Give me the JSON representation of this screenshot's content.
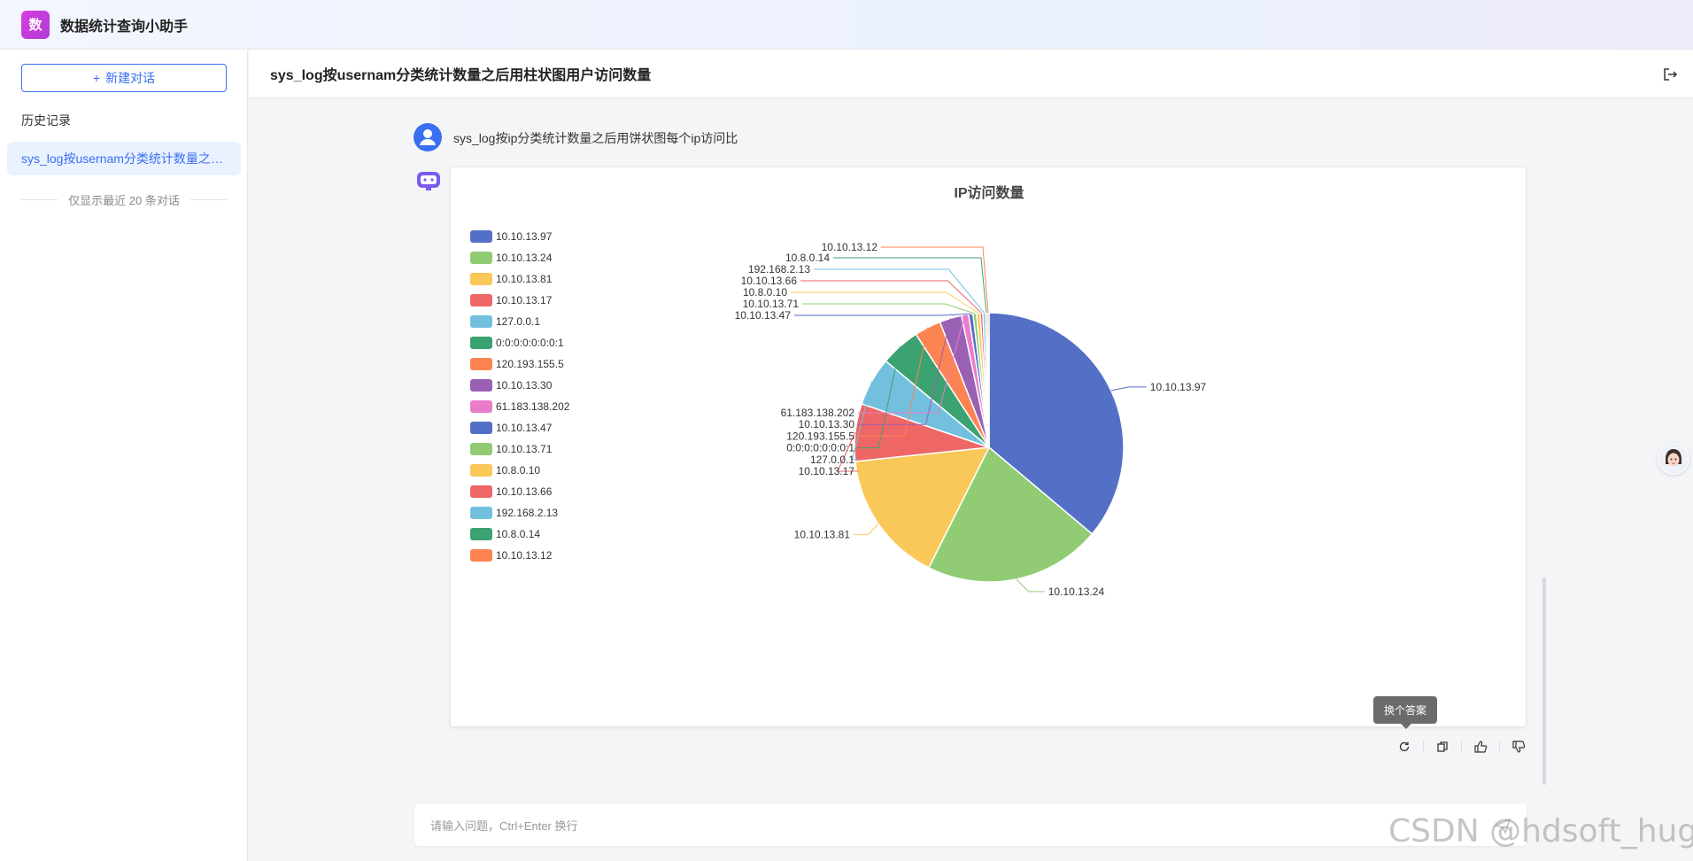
{
  "app": {
    "logo_char": "数",
    "title": "数据统计查询小助手"
  },
  "sidebar": {
    "new_chat_label": "新建对话",
    "history_title": "历史记录",
    "history_items": [
      "sys_log按usernam分类统计数量之后用柱状图用户访问数量"
    ],
    "history_note": "仅显示最近 20 条对话"
  },
  "main": {
    "title": "sys_log按usernam分类统计数量之后用柱状图用户访问数量",
    "user_message": "sys_log按ip分类统计数量之后用饼状图每个ip访问比"
  },
  "chart_data": {
    "type": "pie",
    "title": "IP访问数量",
    "legend_position": "left",
    "colors": [
      "#5470c6",
      "#91cc75",
      "#fac858",
      "#ee6666",
      "#73c0de",
      "#3ba272",
      "#fc8452",
      "#9a60b4",
      "#ea7ccc",
      "#5470c6",
      "#91cc75",
      "#fac858",
      "#ee6666",
      "#73c0de",
      "#3ba272",
      "#fc8452"
    ],
    "labels": [
      "10.10.13.97",
      "10.10.13.24",
      "10.10.13.81",
      "10.10.13.17",
      "127.0.0.1",
      "0:0:0:0:0:0:0:1",
      "120.193.155.5",
      "10.10.13.30",
      "61.183.138.202",
      "10.10.13.47",
      "10.10.13.71",
      "10.8.0.10",
      "10.10.13.66",
      "192.168.2.13",
      "10.8.0.14",
      "10.10.13.12"
    ],
    "values": [
      340,
      200,
      150,
      65,
      55,
      45,
      30,
      25,
      8,
      5,
      4,
      4,
      3,
      3,
      2,
      2
    ]
  },
  "tooltip": {
    "text": "换个答案"
  },
  "input": {
    "placeholder": "请输入问题，Ctrl+Enter 换行"
  },
  "watermark": "CSDN @hdsoft_huge"
}
